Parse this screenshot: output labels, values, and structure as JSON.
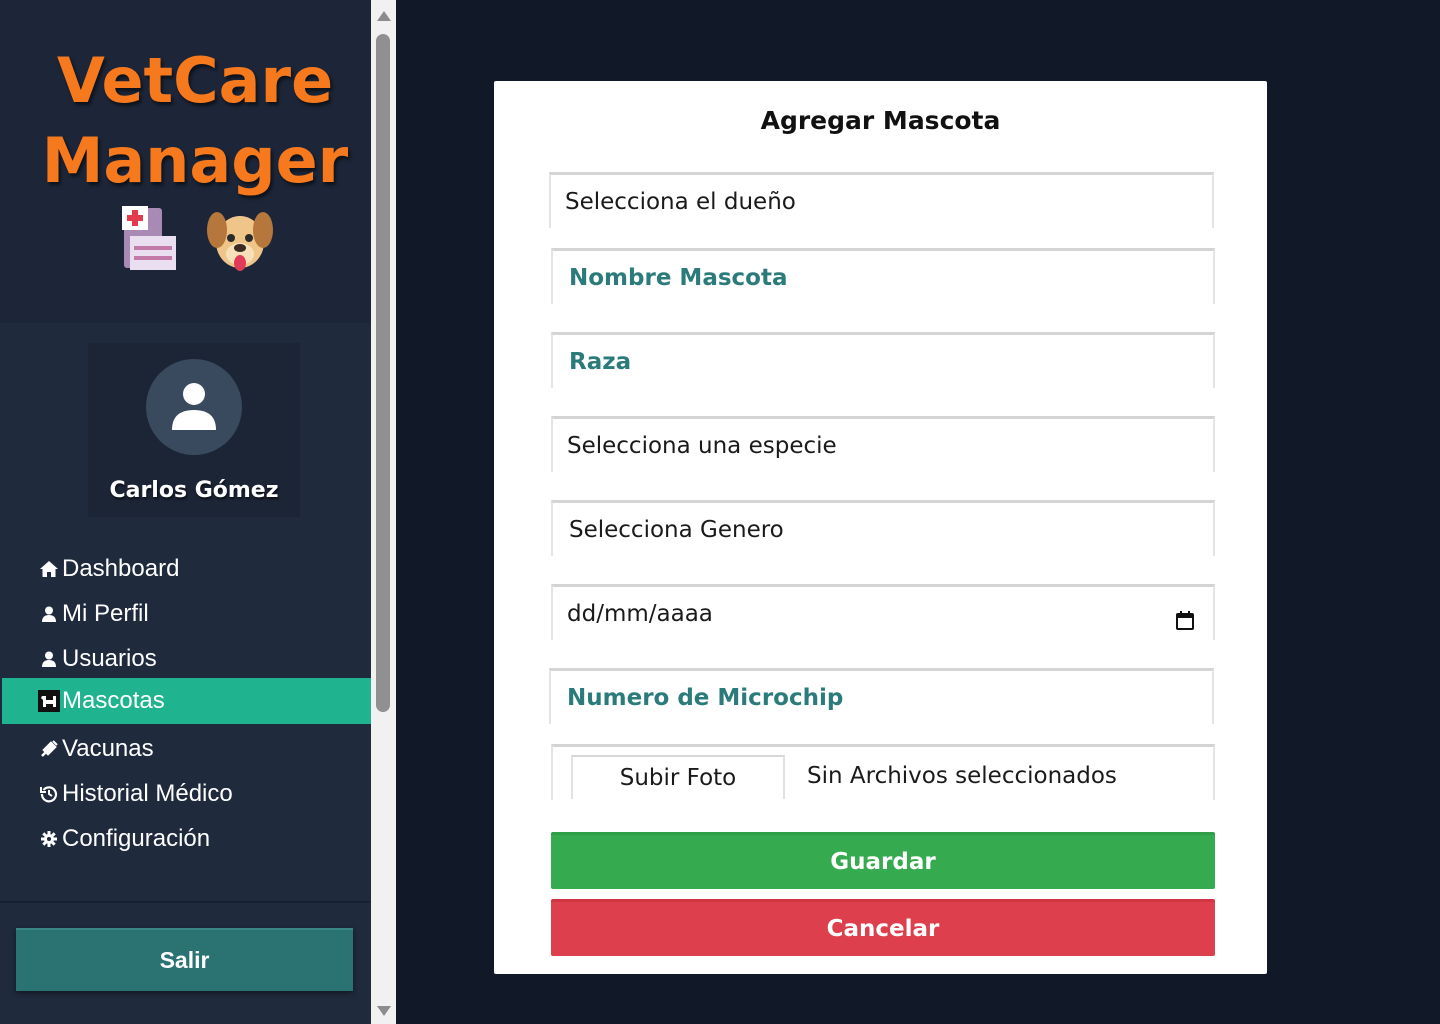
{
  "brand": {
    "line1": "VetCare",
    "line2": "Manager",
    "accent_color": "#f7791e",
    "icons": [
      "clinic-icon",
      "dog-icon"
    ]
  },
  "user": {
    "name": "Carlos Gómez",
    "avatar_icon": "user-icon"
  },
  "nav": {
    "items": [
      {
        "label": "Dashboard",
        "icon": "home-icon"
      },
      {
        "label": "Mi Perfil",
        "icon": "user-icon"
      },
      {
        "label": "Usuarios",
        "icon": "user-icon"
      },
      {
        "label": "Mascotas",
        "icon": "dog-icon",
        "active": true
      },
      {
        "label": "Vacunas",
        "icon": "syringe-icon"
      },
      {
        "label": "Historial Médico",
        "icon": "history-icon"
      },
      {
        "label": "Configuración",
        "icon": "gear-icon"
      }
    ],
    "active_color": "#1fb48f"
  },
  "logout": {
    "label": "Salir"
  },
  "form": {
    "title": "Agregar Mascota",
    "owner_select": "Selecciona el dueño",
    "name_placeholder": "Nombre Mascota",
    "breed_placeholder": "Raza",
    "species_select": "Selecciona una especie",
    "gender_select": "Selecciona Genero",
    "birth_date": "dd/mm/aaaa",
    "chip_placeholder": "Numero de Microchip",
    "upload_label": "Subir Foto",
    "file_status": "Sin Archivos seleccionados",
    "save_label": "Guardar",
    "cancel_label": "Cancelar",
    "save_color": "#35aa4f",
    "cancel_color": "#dd3f4c"
  }
}
